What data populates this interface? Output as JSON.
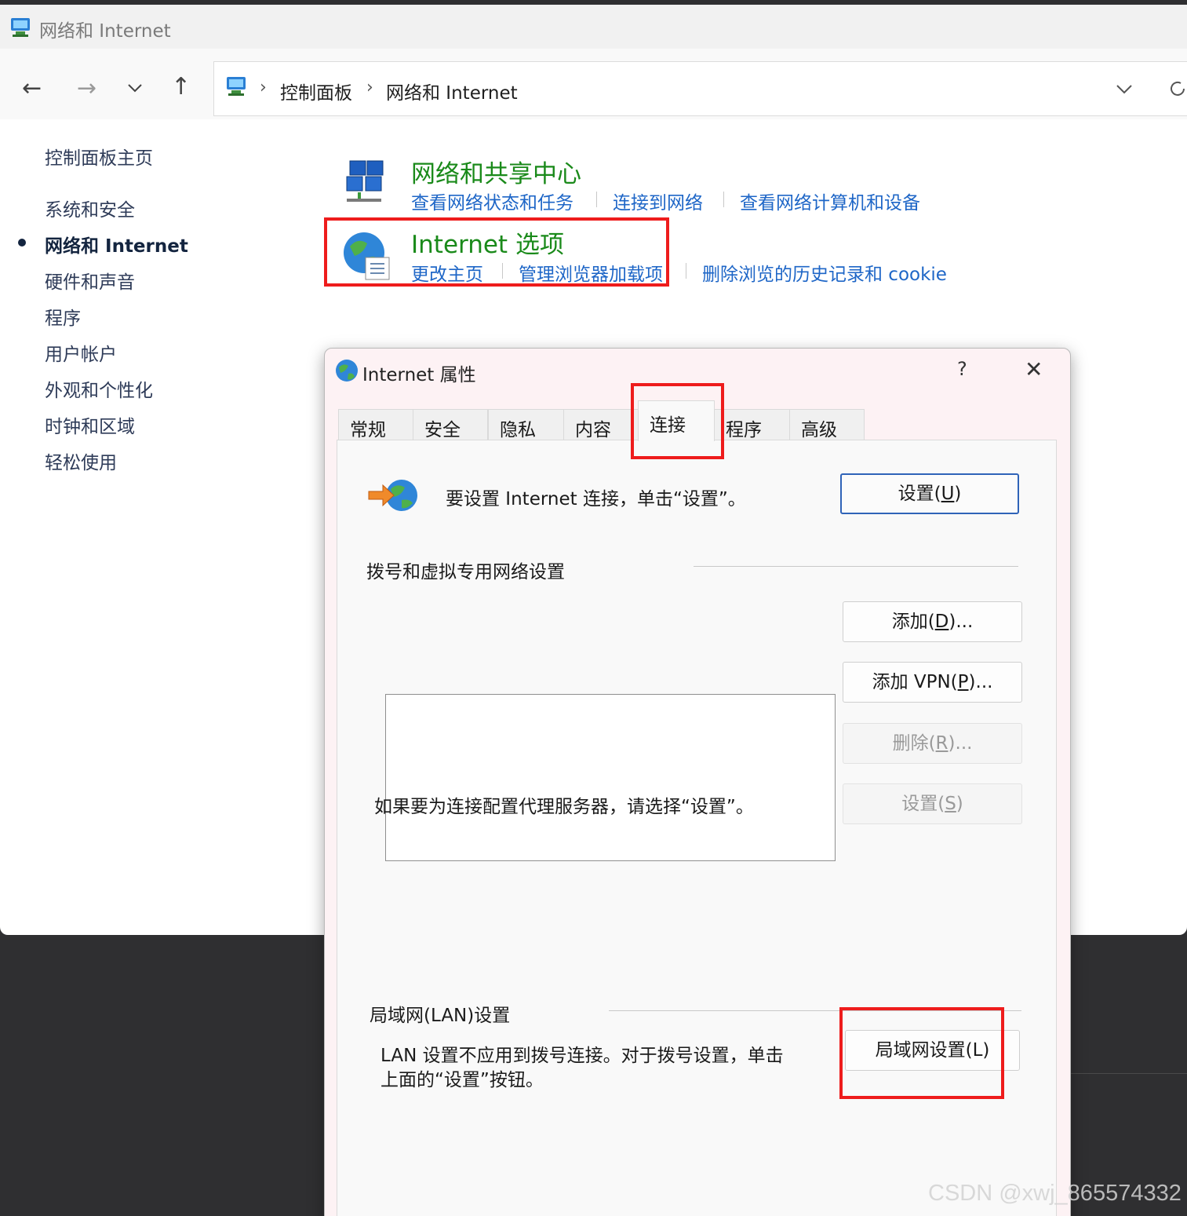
{
  "window": {
    "title": "网络和 Internet"
  },
  "address_bar": {
    "crumbs": [
      "控制面板",
      "网络和 Internet"
    ]
  },
  "left_nav": {
    "items": [
      {
        "label": "控制面板主页"
      },
      {
        "label": "系统和安全"
      },
      {
        "label": "网络和 Internet",
        "active": true
      },
      {
        "label": "硬件和声音"
      },
      {
        "label": "程序"
      },
      {
        "label": "用户帐户"
      },
      {
        "label": "外观和个性化"
      },
      {
        "label": "时钟和区域"
      },
      {
        "label": "轻松使用"
      }
    ]
  },
  "categories": {
    "network_center": {
      "title": "网络和共享中心",
      "links": [
        "查看网络状态和任务",
        "连接到网络",
        "查看网络计算机和设备"
      ]
    },
    "internet_options": {
      "title": "Internet 选项",
      "links": [
        "更改主页",
        "管理浏览器加载项",
        "删除浏览的历史记录和 cookie"
      ]
    }
  },
  "dialog": {
    "title": "Internet 属性",
    "help": "?",
    "tabs": [
      "常规",
      "安全",
      "隐私",
      "内容",
      "连接",
      "程序",
      "高级"
    ],
    "active_tab": "连接",
    "setup_text": "要设置 Internet 连接，单击“设置”。",
    "setup_button": {
      "label": "设置(",
      "key": "U",
      "suffix": ")"
    },
    "dialup_group": "拨号和虚拟专用网络设置",
    "add_button": {
      "label": "添加(",
      "key": "D",
      "suffix": ")..."
    },
    "add_vpn_button": {
      "label": "添加 VPN(",
      "key": "P",
      "suffix": ")..."
    },
    "remove_button": {
      "label": "删除(",
      "key": "R",
      "suffix": ")..."
    },
    "proxy_text": "如果要为连接配置代理服务器，请选择“设置”。",
    "settings_button": {
      "label": "设置(",
      "key": "S",
      "suffix": ")"
    },
    "lan_group": "局域网(LAN)设置",
    "lan_text_line1": "LAN 设置不应用到拨号连接。对于拨号设置，单击",
    "lan_text_line2": "上面的“设置”按钮。",
    "lan_button": {
      "label": "局域网设置(L)"
    }
  },
  "watermark": "CSDN @xwj_865574332",
  "colors": {
    "highlight_box": "#ee1c1c",
    "category_title": "#1a8a1a",
    "link": "#1e66c7"
  }
}
